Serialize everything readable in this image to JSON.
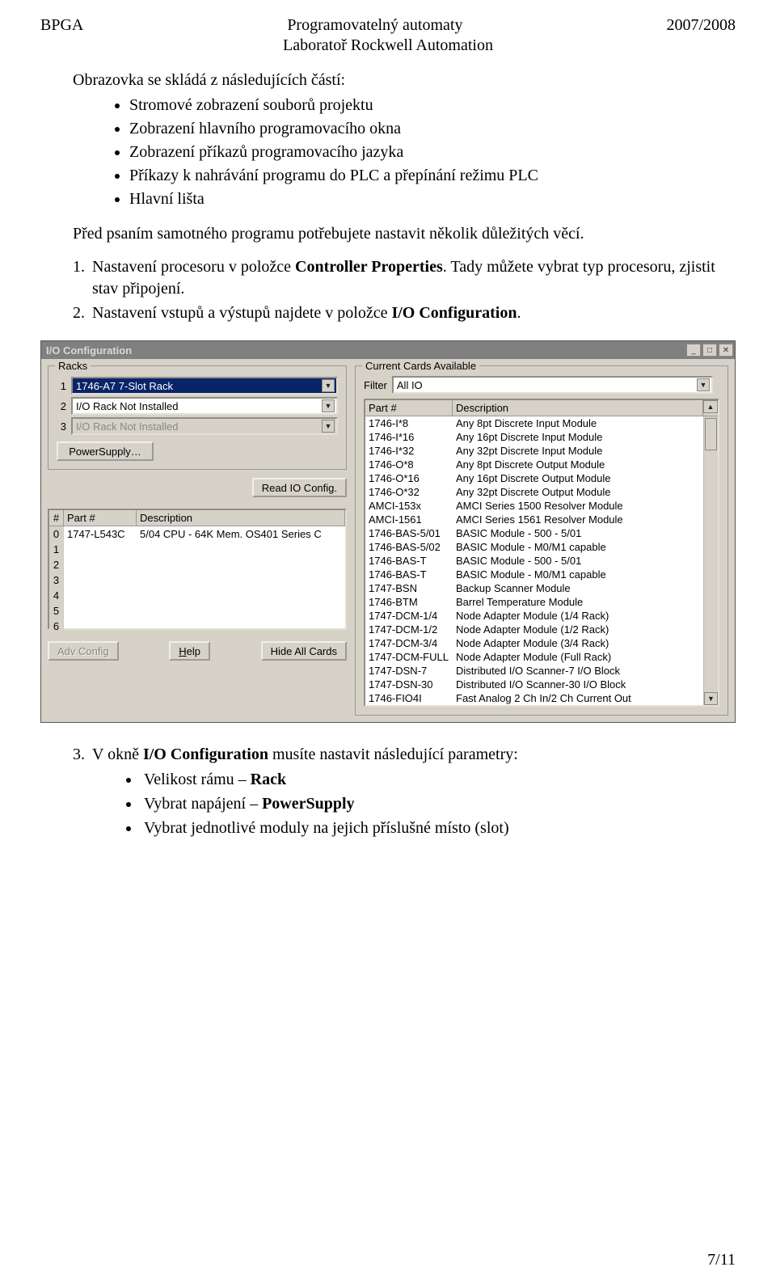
{
  "header": {
    "left": "BPGA",
    "center": "Programovatelný automaty",
    "right": "2007/2008",
    "sub": "Laboratoř Rockwell Automation"
  },
  "intro": "Obrazovka se skládá z následujících částí:",
  "bullets": [
    "Stromové zobrazení souborů projektu",
    "Zobrazení hlavního programovacího okna",
    "Zobrazení příkazů programovacího jazyka",
    "Příkazy k nahrávání programu do PLC a přepínání režimu PLC",
    "Hlavní lišta"
  ],
  "para1": "Před psaním samotného programu potřebujete nastavit několik důležitých věcí.",
  "num1a": "Nastavení procesoru v položce ",
  "num1b": "Controller Properties",
  "num1c": ". Tady můžete vybrat typ procesoru, zjistit stav připojení.",
  "num2a": "Nastavení vstupů a výstupů najdete v položce ",
  "num2b": "I/O Configuration",
  "num2c": ".",
  "after3a": "V okně ",
  "after3b": "I/O Configuration",
  "after3c": " musíte nastavit následující parametry:",
  "bullets2": [
    {
      "pre": "Velikost rámu – ",
      "bold": "Rack"
    },
    {
      "pre": "Vybrat napájení – ",
      "bold": "PowerSupply"
    },
    {
      "pre": "Vybrat jednotlivé moduly na jejich příslušné místo (slot)",
      "bold": ""
    }
  ],
  "footer": "7/11",
  "window": {
    "title": "I/O Configuration",
    "racks_label": "Racks",
    "racks": [
      {
        "n": "1",
        "text": "1746-A7  7-Slot Rack",
        "selected": true,
        "disabled": false
      },
      {
        "n": "2",
        "text": "I/O Rack Not Installed",
        "selected": false,
        "disabled": false
      },
      {
        "n": "3",
        "text": "I/O Rack Not Installed",
        "selected": false,
        "disabled": true
      }
    ],
    "powersupply": "PowerSupply…",
    "readio": "Read IO Config.",
    "pthead": {
      "n": "#",
      "part": "Part #",
      "desc": "Description"
    },
    "ptrows": [
      {
        "n": "0",
        "part": "1747-L543C",
        "desc": "5/04 CPU - 64K Mem. OS401 Series C"
      },
      {
        "n": "1",
        "part": "",
        "desc": ""
      },
      {
        "n": "2",
        "part": "",
        "desc": ""
      },
      {
        "n": "3",
        "part": "",
        "desc": ""
      },
      {
        "n": "4",
        "part": "",
        "desc": ""
      },
      {
        "n": "5",
        "part": "",
        "desc": ""
      },
      {
        "n": "6",
        "part": "",
        "desc": ""
      }
    ],
    "adv": "Adv Config",
    "help": "Help",
    "hide": "Hide All Cards",
    "cards_label": "Current Cards Available",
    "filter_label": "Filter",
    "filter_value": "All IO",
    "cthead": {
      "part": "Part #",
      "desc": "Description"
    },
    "cards": [
      {
        "part": "1746-I*8",
        "desc": "Any 8pt Discrete Input Module"
      },
      {
        "part": "1746-I*16",
        "desc": "Any 16pt Discrete Input Module"
      },
      {
        "part": "1746-I*32",
        "desc": "Any 32pt Discrete Input Module"
      },
      {
        "part": "1746-O*8",
        "desc": "Any 8pt Discrete Output Module"
      },
      {
        "part": "1746-O*16",
        "desc": "Any 16pt Discrete Output Module"
      },
      {
        "part": "1746-O*32",
        "desc": "Any 32pt Discrete Output Module"
      },
      {
        "part": "AMCI-153x",
        "desc": "AMCI Series 1500 Resolver Module"
      },
      {
        "part": "AMCI-1561",
        "desc": "AMCI Series 1561 Resolver Module"
      },
      {
        "part": "1746-BAS-5/01",
        "desc": "BASIC Module - 500 - 5/01"
      },
      {
        "part": "1746-BAS-5/02",
        "desc": "BASIC Module - M0/M1 capable"
      },
      {
        "part": "1746-BAS-T",
        "desc": "BASIC Module - 500 - 5/01"
      },
      {
        "part": "1746-BAS-T",
        "desc": "BASIC Module - M0/M1 capable"
      },
      {
        "part": "1747-BSN",
        "desc": "Backup Scanner Module"
      },
      {
        "part": "1746-BTM",
        "desc": "Barrel Temperature Module"
      },
      {
        "part": "1747-DCM-1/4",
        "desc": "Node Adapter Module (1/4 Rack)"
      },
      {
        "part": "1747-DCM-1/2",
        "desc": "Node Adapter Module (1/2 Rack)"
      },
      {
        "part": "1747-DCM-3/4",
        "desc": "Node Adapter Module (3/4 Rack)"
      },
      {
        "part": "1747-DCM-FULL",
        "desc": "Node Adapter Module (Full Rack)"
      },
      {
        "part": "1747-DSN-7",
        "desc": "Distributed I/O Scanner-7 I/O Block"
      },
      {
        "part": "1747-DSN-30",
        "desc": "Distributed I/O Scanner-30 I/O Block"
      },
      {
        "part": "1746-FIO4I",
        "desc": "Fast Analog 2 Ch In/2 Ch Current Out"
      }
    ]
  }
}
